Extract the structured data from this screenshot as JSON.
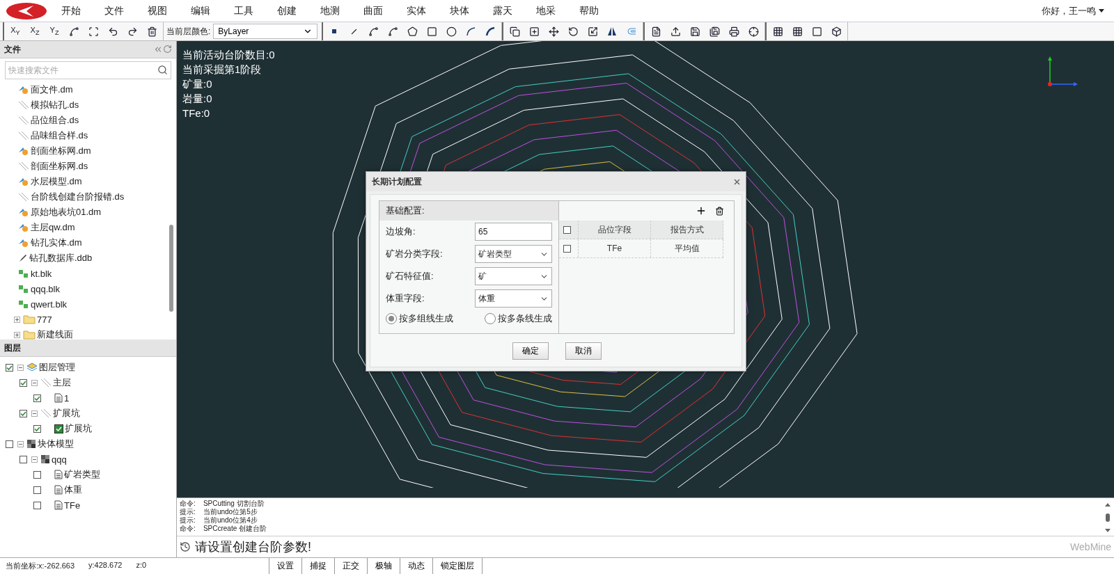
{
  "menu": {
    "items": [
      "开始",
      "文件",
      "视图",
      "编辑",
      "工具",
      "创建",
      "地测",
      "曲面",
      "实体",
      "块体",
      "露天",
      "地采",
      "帮助"
    ],
    "user": "你好，王一鸣"
  },
  "toolbar": {
    "views": [
      "X$_{Y}$",
      "X$_{Z}$",
      "Y$_{Z}$"
    ],
    "layer_color_label": "当前层颜色:",
    "layer_color_value": "ByLayer"
  },
  "files_panel": {
    "title": "文件",
    "search_placeholder": "快速搜索文件",
    "items": [
      {
        "name": "面文件.dm",
        "kind": "dm"
      },
      {
        "name": "模拟钻孔.ds",
        "kind": "ds"
      },
      {
        "name": "品位组合.ds",
        "kind": "ds"
      },
      {
        "name": "品味组合样.ds",
        "kind": "ds"
      },
      {
        "name": "剖面坐标网.dm",
        "kind": "dm"
      },
      {
        "name": "剖面坐标网.ds",
        "kind": "ds"
      },
      {
        "name": "水层模型.dm",
        "kind": "dm"
      },
      {
        "name": "台阶线创建台阶报错.ds",
        "kind": "ds"
      },
      {
        "name": "原始地表坑01.dm",
        "kind": "dm"
      },
      {
        "name": "主层qw.dm",
        "kind": "dm"
      },
      {
        "name": "钻孔实体.dm",
        "kind": "dm"
      },
      {
        "name": "钻孔数据库.ddb",
        "kind": "ddb"
      },
      {
        "name": "kt.blk",
        "kind": "blk"
      },
      {
        "name": "qqq.blk",
        "kind": "blk"
      },
      {
        "name": "qwert.blk",
        "kind": "blk"
      },
      {
        "name": "777",
        "kind": "folder",
        "expanded": false
      },
      {
        "name": "新建线面",
        "kind": "folder",
        "expanded": false
      }
    ]
  },
  "layers_panel": {
    "title": "图层",
    "tree": [
      {
        "label": "图层管理",
        "kind": "stack",
        "checked": true,
        "expanded": true,
        "children": [
          {
            "label": "主层",
            "kind": "lines",
            "checked": true,
            "expanded": true,
            "children": [
              {
                "label": "1",
                "kind": "doc",
                "checked": true
              }
            ]
          },
          {
            "label": "扩展坑",
            "kind": "lines",
            "checked": true,
            "expanded": true,
            "children": [
              {
                "label": "扩展坑",
                "kind": "tick",
                "checked": true
              }
            ]
          }
        ]
      },
      {
        "label": "块体模型",
        "kind": "block",
        "checked": false,
        "expanded": true,
        "children": [
          {
            "label": "qqq",
            "kind": "block",
            "checked": false,
            "expanded": true,
            "children": [
              {
                "label": "矿岩类型",
                "kind": "doc",
                "checked": false
              },
              {
                "label": "体重",
                "kind": "doc",
                "checked": false
              },
              {
                "label": "TFe",
                "kind": "doc",
                "checked": false
              }
            ]
          }
        ]
      }
    ]
  },
  "canvas": {
    "info": [
      "当前活动台阶数目:0",
      "当前采掘第1阶段",
      "矿量:0",
      "岩量:0",
      "TFe:0"
    ]
  },
  "dialog": {
    "title": "长期计划配置",
    "section": "基础配置:",
    "fields": [
      {
        "label": "边坡角:",
        "value": "65",
        "kind": "input"
      },
      {
        "label": "矿岩分类字段:",
        "value": "矿岩类型",
        "kind": "select"
      },
      {
        "label": "矿石特征值:",
        "value": "矿",
        "kind": "select"
      },
      {
        "label": "体重字段:",
        "value": "体重",
        "kind": "select"
      }
    ],
    "radios": [
      {
        "label": "按多组线生成",
        "selected": true
      },
      {
        "label": "按多条线生成",
        "selected": false
      }
    ],
    "table": {
      "all_checked": false,
      "columns": [
        "品位字段",
        "报告方式"
      ],
      "rows": [
        {
          "checked": false,
          "cells": [
            "TFe",
            "平均值"
          ]
        }
      ]
    },
    "buttons": [
      "确定",
      "取消"
    ]
  },
  "command_log": [
    {
      "tag": "命令:",
      "text": "SPCutting 切割台阶"
    },
    {
      "tag": "提示:",
      "text": "当前undo位第5步"
    },
    {
      "tag": "提示:",
      "text": "当前undo位第4步"
    },
    {
      "tag": "命令:",
      "text": "SPCcreate 创建台阶"
    }
  ],
  "prompt": "请设置创建台阶参数!",
  "brand": "WebMine",
  "status_bar": {
    "coords": [
      "当前坐标:x:-262.663",
      "y:428.672",
      "z:0"
    ],
    "buttons": [
      "设置",
      "捕捉",
      "正交",
      "极轴",
      "动态",
      "锁定图层"
    ]
  }
}
